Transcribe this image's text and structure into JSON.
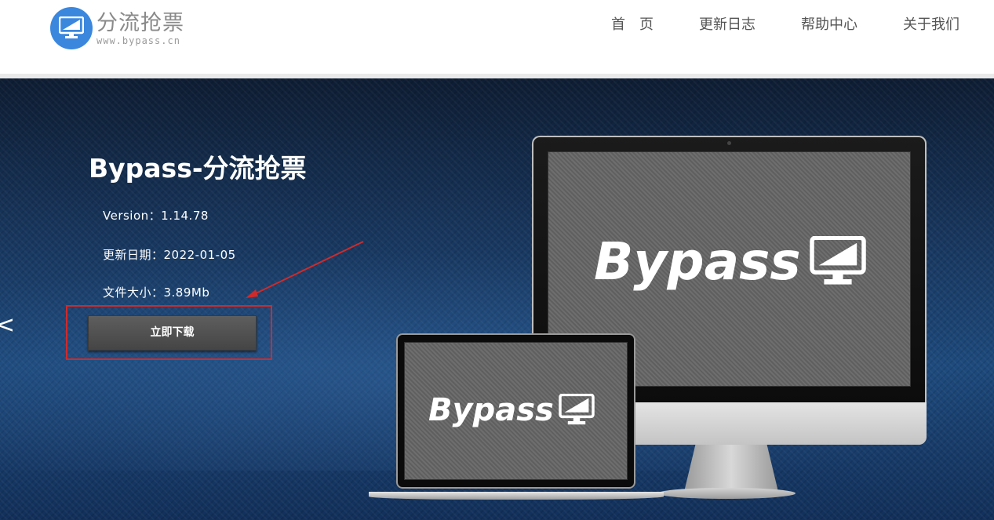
{
  "header": {
    "logo_title": "分流抢票",
    "logo_subtitle": "www.bypass.cn",
    "nav": [
      {
        "label": "首　页"
      },
      {
        "label": "更新日志"
      },
      {
        "label": "帮助中心"
      },
      {
        "label": "关于我们"
      }
    ]
  },
  "hero": {
    "title": "Bypass-分流抢票",
    "version": "Version：1.14.78",
    "update_date": "更新日期：2022-01-05",
    "file_size": "文件大小：3.89Mb",
    "download_label": "立即下载",
    "prev_arrow": "<"
  },
  "devices": {
    "monitor_brand": "Bypass",
    "laptop_brand": "Bypass"
  },
  "colors": {
    "accent": "#3b87de",
    "highlight": "#d12a2a",
    "hero_bg": "#193a63"
  }
}
